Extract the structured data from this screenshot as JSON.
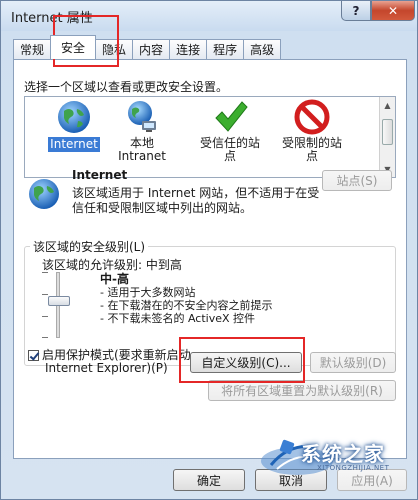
{
  "window": {
    "title": "Internet 属性",
    "help_label": "?",
    "close_label": "✕"
  },
  "tabs": [
    {
      "label": "常规"
    },
    {
      "label": "安全"
    },
    {
      "label": "隐私"
    },
    {
      "label": "内容"
    },
    {
      "label": "连接"
    },
    {
      "label": "程序"
    },
    {
      "label": "高级"
    }
  ],
  "security": {
    "prompt": "选择一个区域以查看或更改安全设置。",
    "zones": [
      {
        "label_line1": "Internet",
        "label_line2": "",
        "icon": "globe-icon",
        "selected": true
      },
      {
        "label_line1": "本地",
        "label_line2": "Intranet",
        "icon": "network-globe-icon",
        "selected": false
      },
      {
        "label_line1": "受信任的站",
        "label_line2": "点",
        "icon": "check-mark-icon",
        "selected": false
      },
      {
        "label_line1": "受限制的站",
        "label_line2": "点",
        "icon": "no-entry-icon",
        "selected": false
      }
    ],
    "zone_title": "Internet",
    "zone_desc": "该区域适用于 Internet 网站，但不适用于在受信任和受限制区域中列出的网站。",
    "sites_button": "站点(S)",
    "group_legend": "该区域的安全级别(L)",
    "allowed_level": "该区域的允许级别: 中到高",
    "level_name": "中-高",
    "bullets": [
      "适用于大多数网站",
      "在下载潜在的不安全内容之前提示",
      "不下载未签名的 ActiveX 控件"
    ],
    "protected_mode_line1": "启用保护模式(要求重新启动",
    "protected_mode_line2": "Internet Explorer)(P)",
    "custom_level_button": "自定义级别(C)...",
    "default_level_button": "默认级别(D)",
    "reset_all_button": "将所有区域重置为默认级别(R)"
  },
  "footer": {
    "ok": "确定",
    "cancel": "取消",
    "apply": "应用(A)"
  },
  "watermark": {
    "text": "系统之家",
    "url": "XITONGZHIJIA.NET"
  },
  "colors": {
    "highlight": "#e42727",
    "selection": "#3a7bd5"
  }
}
